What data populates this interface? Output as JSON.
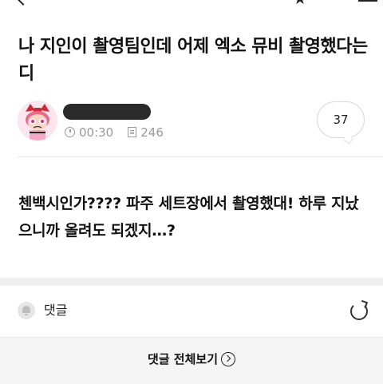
{
  "post": {
    "title": "나 지인이 촬영팀인데 어제 엑소 뮤비 촬영했다는디",
    "meta": {
      "time": "00:30",
      "views": "246"
    },
    "comment_count": "37",
    "body": "첸백시인가???? 파주 세트장에서 촬영했대! 하루 지났으니까 올려도 되겠지…?"
  },
  "comments": {
    "label": "댓글",
    "view_all_label": "댓글 전체보기"
  },
  "icons": {
    "back": "chevron-left-icon",
    "star": "star-icon",
    "menu": "menu-icon",
    "clock": "clock-icon",
    "views": "document-icon",
    "bell": "bell-icon",
    "refresh": "refresh-icon",
    "view_all": "chevron-circle-right-icon"
  },
  "colors": {
    "text": "#111111",
    "meta": "#9a9a9a",
    "section_gap": "#f0f0f0",
    "footer": "#f5f5f5"
  }
}
